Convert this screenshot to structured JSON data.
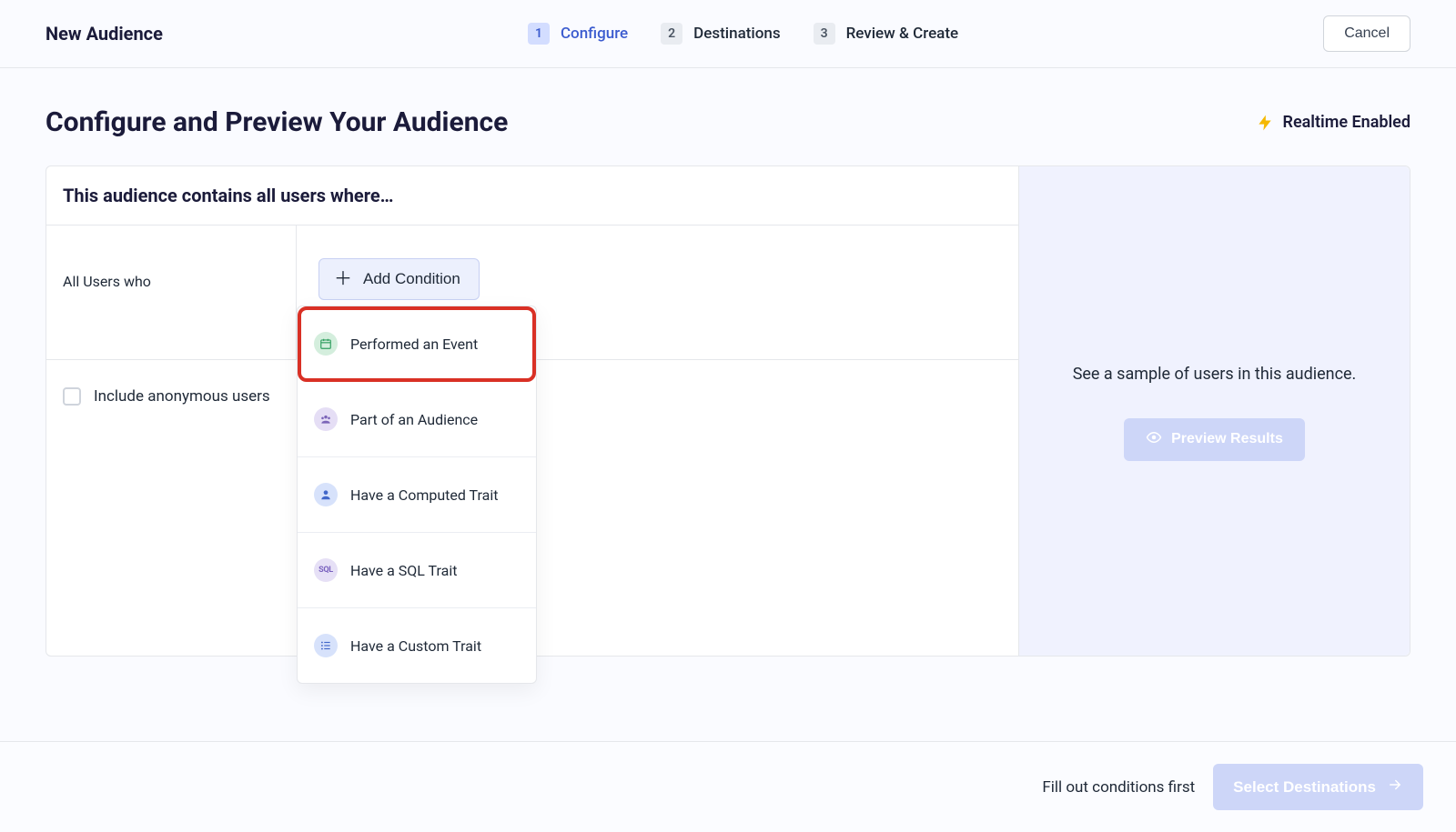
{
  "header": {
    "title": "New Audience",
    "cancel_label": "Cancel"
  },
  "steps": [
    {
      "num": "1",
      "label": "Configure"
    },
    {
      "num": "2",
      "label": "Destinations"
    },
    {
      "num": "3",
      "label": "Review & Create"
    }
  ],
  "page": {
    "heading": "Configure and Preview Your Audience",
    "realtime_label": "Realtime Enabled"
  },
  "builder": {
    "description": "This audience contains all users where…",
    "prefix": "All Users who",
    "add_condition_label": "Add Condition",
    "anon_label": "Include anonymous users"
  },
  "dropdown": {
    "items": [
      {
        "icon": "calendar",
        "label": "Performed an Event"
      },
      {
        "icon": "people",
        "label": "Part of an Audience"
      },
      {
        "icon": "user",
        "label": "Have a Computed Trait"
      },
      {
        "icon": "sql",
        "label": "Have a SQL Trait"
      },
      {
        "icon": "list",
        "label": "Have a Custom Trait"
      }
    ]
  },
  "sidebar": {
    "text": "See a sample of users in this audience.",
    "preview_label": "Preview Results"
  },
  "footer": {
    "hint": "Fill out conditions first",
    "select_label": "Select Destinations"
  }
}
